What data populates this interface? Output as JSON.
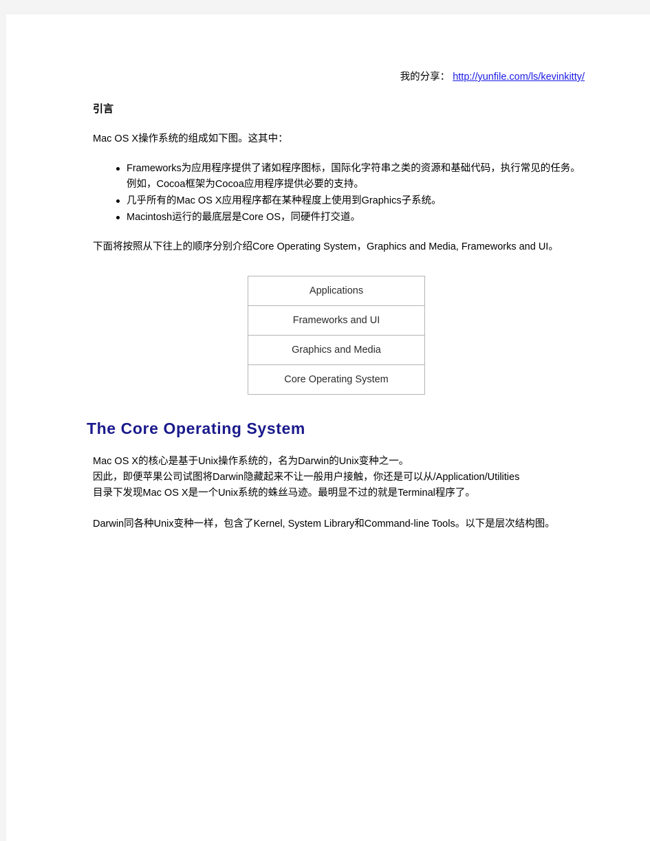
{
  "document": {
    "share": {
      "label": "我的分享：",
      "link_text": "http://yunfile.com/ls/kevinkitty/",
      "link_color": "#1a1ae6"
    },
    "intro": {
      "heading": "引言",
      "lead_paragraph": "Mac OS X操作系统的组成如下图。这其中：",
      "bullets": [
        "Frameworks为应用程序提供了诸如程序图标，国际化字符串之类的资源和基础代码，执行常见的任务。例如，Cocoa框架为Cocoa应用程序提供必要的支持。",
        "几乎所有的Mac OS X应用程序都在某种程度上使用到Graphics子系统。",
        "Macintosh运行的最底层是Core OS，同硬件打交道。"
      ],
      "closing_paragraph": "下面将按照从下往上的顺序分别介绍Core Operating System，Graphics and Media, Frameworks and UI。"
    },
    "diagram": {
      "name": "mac-os-x-architecture-stack",
      "border_color": "#b4b4b4",
      "layers": [
        "Applications",
        "Frameworks and UI",
        "Graphics and Media",
        "Core Operating System"
      ]
    },
    "core_os_section": {
      "heading": "The Core Operating System",
      "heading_color": "#1a1a8c",
      "paragraph_1_lines": [
        "Mac OS X的核心是基于Unix操作系统的，名为Darwin的Unix变种之一。",
        "因此，即便苹果公司试图将Darwin隐藏起来不让一般用户接触，你还是可以从/Application/Utilities",
        "目录下发现Mac OS X是一个Unix系统的蛛丝马迹。最明显不过的就是Terminal程序了。"
      ],
      "paragraph_2": "Darwin同各种Unix变种一样，包含了Kernel, System Library和Command-line Tools。以下是层次结构图。"
    }
  }
}
